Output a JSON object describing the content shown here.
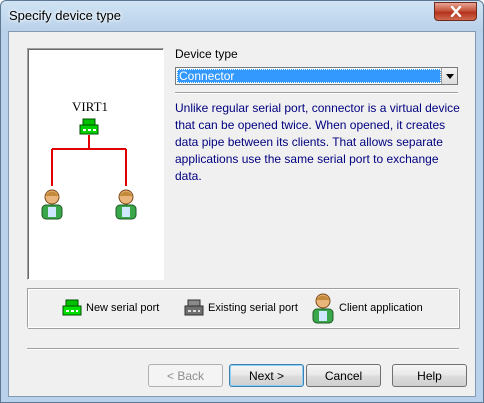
{
  "window": {
    "title": "Specify device type"
  },
  "diagram": {
    "port_name": "VIRT1"
  },
  "device_type": {
    "label": "Device type",
    "selected": "Connector"
  },
  "description": "Unlike regular serial port, connector is a virtual device that can be opened twice. When opened, it creates data pipe between its clients. That allows separate applications use the same serial port to exchange data.",
  "legend": {
    "new_port": "New serial port",
    "existing_port": "Existing serial port",
    "client_app": "Client application"
  },
  "buttons": {
    "back": "< Back",
    "next": "Next >",
    "cancel": "Cancel",
    "help": "Help"
  },
  "colors": {
    "new_port": "#00c000",
    "existing_port": "#808080",
    "link_line": "#e00000",
    "description_text": "#000080",
    "selection": "#3399ff"
  },
  "icons": {
    "new_port": "serial-port-green-icon",
    "existing_port": "serial-port-gray-icon",
    "client": "client-application-icon",
    "close": "close-icon",
    "dropdown": "chevron-down-icon"
  }
}
